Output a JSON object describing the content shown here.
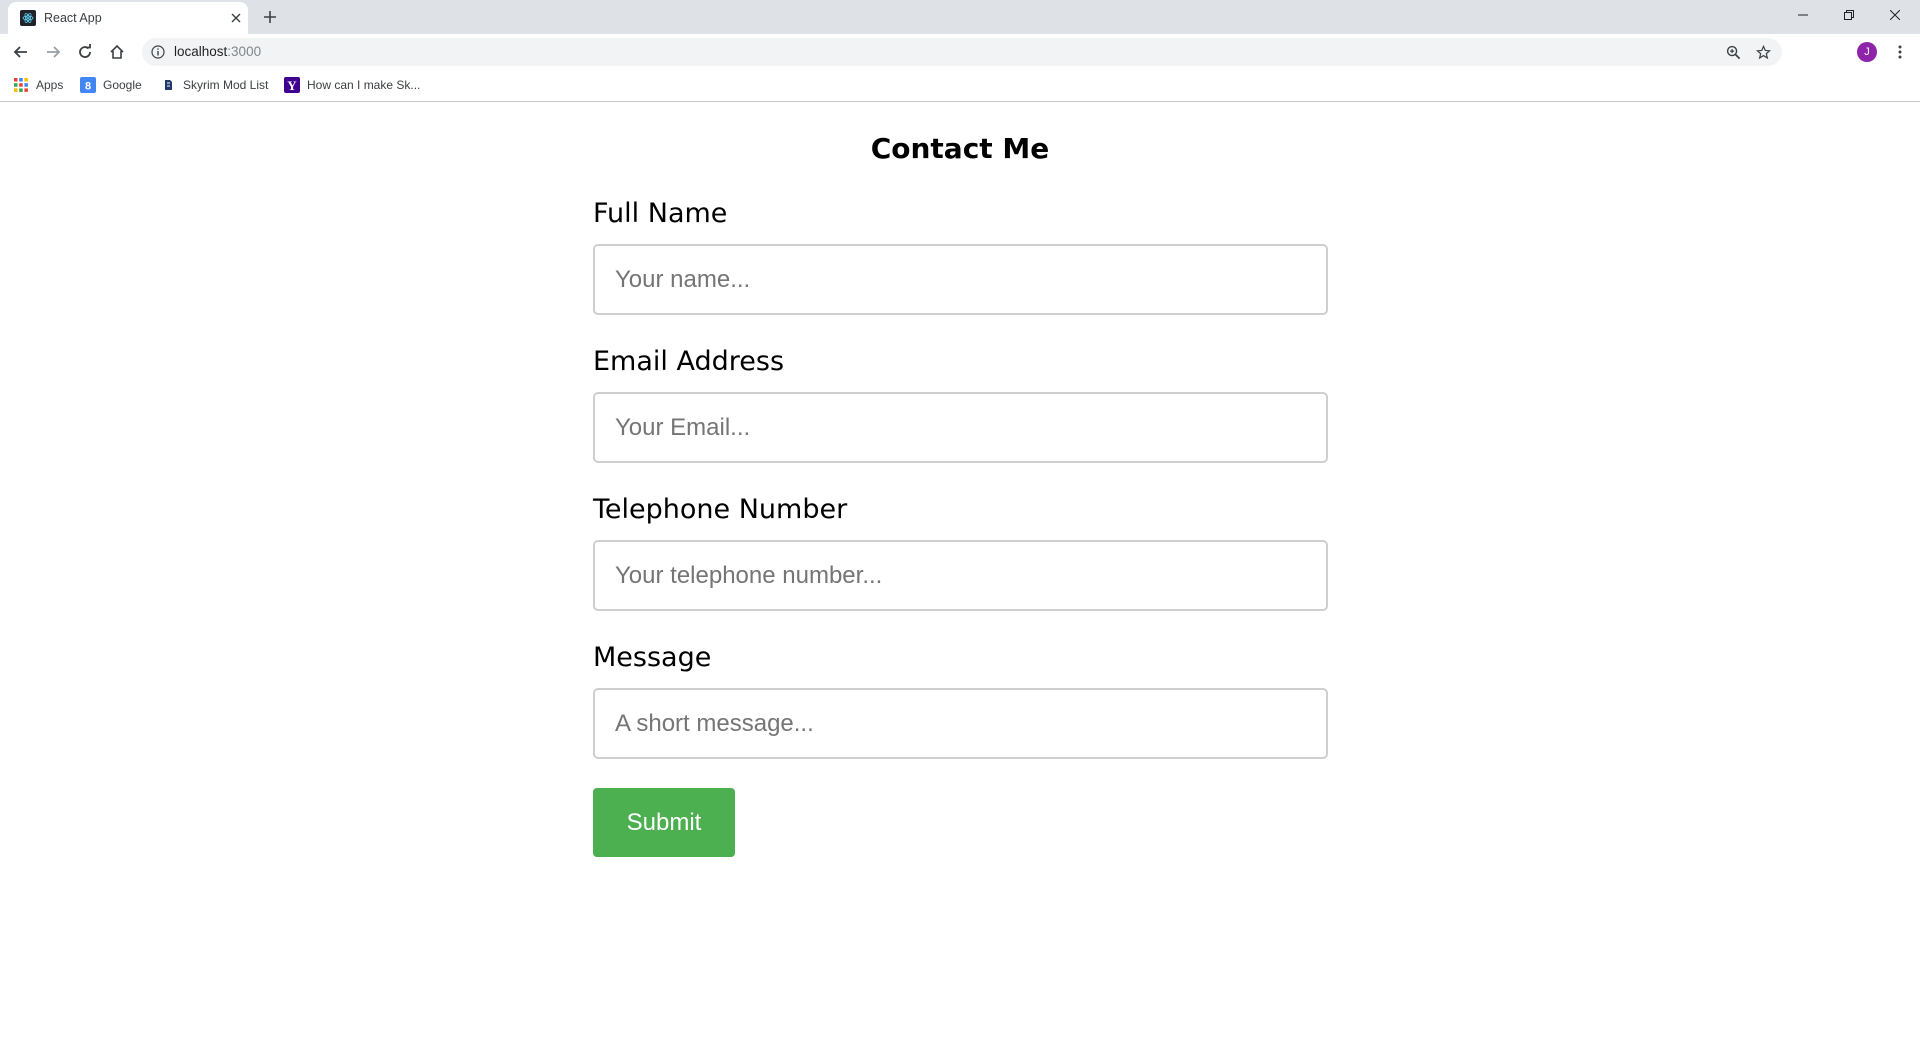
{
  "browser": {
    "tab": {
      "title": "React App"
    },
    "address_bar": {
      "url_host": "localhost",
      "url_port": ":3000"
    },
    "profile_initial": "J",
    "bookmarks": [
      {
        "label": "Apps",
        "icon": "apps-grid-icon"
      },
      {
        "label": "Google",
        "icon": "google-favicon"
      },
      {
        "label": "Skyrim Mod List",
        "icon": "skyrim-favicon"
      },
      {
        "label": "How can I make Sk...",
        "icon": "yahoo-favicon"
      }
    ]
  },
  "form": {
    "title": "Contact Me",
    "fields": [
      {
        "label": "Full Name",
        "placeholder": "Your name..."
      },
      {
        "label": "Email Address",
        "placeholder": "Your Email..."
      },
      {
        "label": "Telephone Number",
        "placeholder": "Your telephone number..."
      },
      {
        "label": "Message",
        "placeholder": "A short message..."
      }
    ],
    "submit_label": "Submit"
  },
  "colors": {
    "submit_button": "#4caf50",
    "avatar": "#8e24aa",
    "tabstrip": "#dee1e6"
  }
}
